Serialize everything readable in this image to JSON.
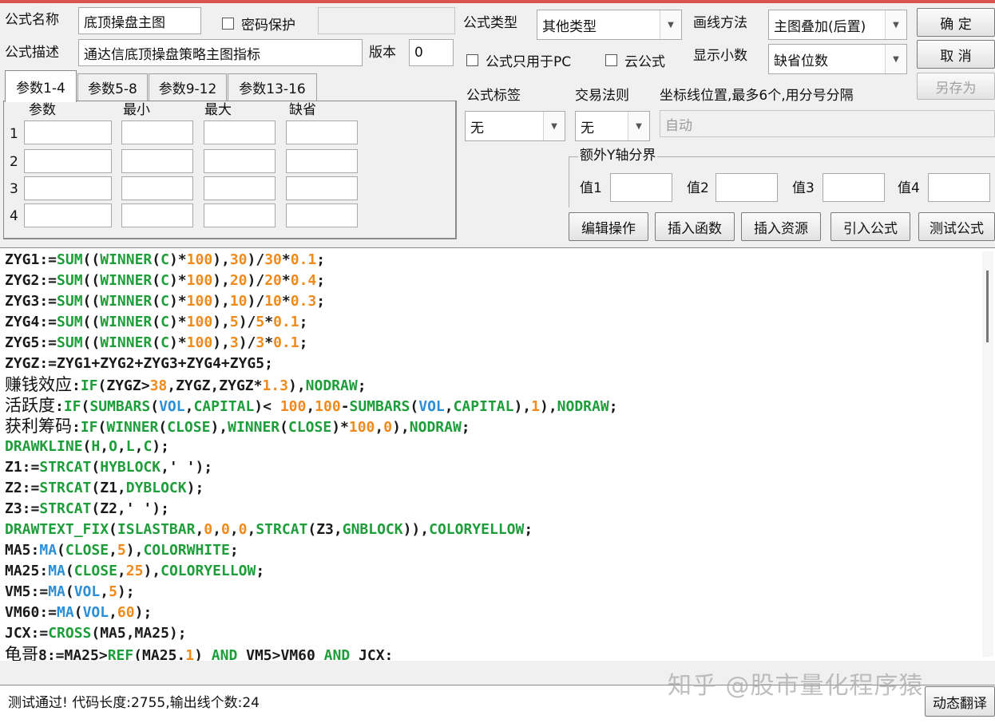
{
  "form": {
    "name_label": "公式名称",
    "name_value": "底顶操盘主图",
    "password_label": "密码保护",
    "desc_label": "公式描述",
    "desc_value": "通达信底顶操盘策略主图指标",
    "version_label": "版本",
    "version_value": "0",
    "type_label": "公式类型",
    "type_value": "其他类型",
    "draw_label": "画线方法",
    "draw_value": "主图叠加(后置)",
    "pc_only_label": "公式只用于PC",
    "cloud_label": "云公式",
    "decimals_label": "显示小数",
    "decimals_value": "缺省位数",
    "tag_label": "公式标签",
    "tag_value": "无",
    "rule_label": "交易法则",
    "rule_value": "无",
    "coord_label": "坐标线位置,最多6个,用分号分隔",
    "coord_placeholder": "自动",
    "yaxis_label": "额外Y轴分界",
    "y_values": [
      "值1",
      "值2",
      "值3",
      "值4"
    ]
  },
  "buttons": {
    "ok": "确  定",
    "cancel": "取  消",
    "save_as": "另存为",
    "edit": "编辑操作",
    "insert_func": "插入函数",
    "insert_res": "插入资源",
    "import": "引入公式",
    "test": "测试公式",
    "translate": "动态翻译"
  },
  "tabs": [
    "参数1-4",
    "参数5-8",
    "参数9-12",
    "参数13-16"
  ],
  "param_headers": [
    "参数",
    "最小",
    "最大",
    "缺省"
  ],
  "param_rows": [
    "1",
    "2",
    "3",
    "4"
  ],
  "code_lines": [
    [
      [
        "k",
        "ZYG1:="
      ],
      [
        "f",
        "SUM"
      ],
      [
        "k",
        "(("
      ],
      [
        "f",
        "WINNER"
      ],
      [
        "k",
        "("
      ],
      [
        "f",
        "C"
      ],
      [
        "k",
        ")*"
      ],
      [
        "n",
        "100"
      ],
      [
        "k",
        "),"
      ],
      [
        "n",
        "30"
      ],
      [
        "k",
        ")/"
      ],
      [
        "n",
        "30"
      ],
      [
        "k",
        "*"
      ],
      [
        "n",
        "0.1"
      ],
      [
        "k",
        ";"
      ]
    ],
    [
      [
        "k",
        "ZYG2:="
      ],
      [
        "f",
        "SUM"
      ],
      [
        "k",
        "(("
      ],
      [
        "f",
        "WINNER"
      ],
      [
        "k",
        "("
      ],
      [
        "f",
        "C"
      ],
      [
        "k",
        ")*"
      ],
      [
        "n",
        "100"
      ],
      [
        "k",
        "),"
      ],
      [
        "n",
        "20"
      ],
      [
        "k",
        ")/"
      ],
      [
        "n",
        "20"
      ],
      [
        "k",
        "*"
      ],
      [
        "n",
        "0.4"
      ],
      [
        "k",
        ";"
      ]
    ],
    [
      [
        "k",
        "ZYG3:="
      ],
      [
        "f",
        "SUM"
      ],
      [
        "k",
        "(("
      ],
      [
        "f",
        "WINNER"
      ],
      [
        "k",
        "("
      ],
      [
        "f",
        "C"
      ],
      [
        "k",
        ")*"
      ],
      [
        "n",
        "100"
      ],
      [
        "k",
        "),"
      ],
      [
        "n",
        "10"
      ],
      [
        "k",
        ")/"
      ],
      [
        "n",
        "10"
      ],
      [
        "k",
        "*"
      ],
      [
        "n",
        "0.3"
      ],
      [
        "k",
        ";"
      ]
    ],
    [
      [
        "k",
        "ZYG4:="
      ],
      [
        "f",
        "SUM"
      ],
      [
        "k",
        "(("
      ],
      [
        "f",
        "WINNER"
      ],
      [
        "k",
        "("
      ],
      [
        "f",
        "C"
      ],
      [
        "k",
        ")*"
      ],
      [
        "n",
        "100"
      ],
      [
        "k",
        "),"
      ],
      [
        "n",
        "5"
      ],
      [
        "k",
        ")/"
      ],
      [
        "n",
        "5"
      ],
      [
        "k",
        "*"
      ],
      [
        "n",
        "0.1"
      ],
      [
        "k",
        ";"
      ]
    ],
    [
      [
        "k",
        "ZYG5:="
      ],
      [
        "f",
        "SUM"
      ],
      [
        "k",
        "(("
      ],
      [
        "f",
        "WINNER"
      ],
      [
        "k",
        "("
      ],
      [
        "f",
        "C"
      ],
      [
        "k",
        ")*"
      ],
      [
        "n",
        "100"
      ],
      [
        "k",
        "),"
      ],
      [
        "n",
        "3"
      ],
      [
        "k",
        ")/"
      ],
      [
        "n",
        "3"
      ],
      [
        "k",
        "*"
      ],
      [
        "n",
        "0.1"
      ],
      [
        "k",
        ";"
      ]
    ],
    [
      [
        "k",
        "ZYGZ:=ZYG1+ZYG2+ZYG3+ZYG4+ZYG5;"
      ]
    ],
    [
      [
        "c",
        "赚钱效应"
      ],
      [
        "k",
        ":"
      ],
      [
        "f",
        "IF"
      ],
      [
        "k",
        "(ZYGZ>"
      ],
      [
        "n",
        "38"
      ],
      [
        "k",
        ",ZYGZ,ZYGZ*"
      ],
      [
        "n",
        "1.3"
      ],
      [
        "k",
        "),"
      ],
      [
        "f",
        "NODRAW"
      ],
      [
        "k",
        ";"
      ]
    ],
    [
      [
        "c",
        "活跃度"
      ],
      [
        "k",
        ":"
      ],
      [
        "f",
        "IF"
      ],
      [
        "k",
        "("
      ],
      [
        "f",
        "SUMBARS"
      ],
      [
        "k",
        "("
      ],
      [
        "b",
        "VOL"
      ],
      [
        "k",
        ","
      ],
      [
        "f",
        "CAPITAL"
      ],
      [
        "k",
        ")< "
      ],
      [
        "n",
        "100"
      ],
      [
        "k",
        ","
      ],
      [
        "n",
        "100"
      ],
      [
        "k",
        "-"
      ],
      [
        "f",
        "SUMBARS"
      ],
      [
        "k",
        "("
      ],
      [
        "b",
        "VOL"
      ],
      [
        "k",
        ","
      ],
      [
        "f",
        "CAPITAL"
      ],
      [
        "k",
        "),"
      ],
      [
        "n",
        "1"
      ],
      [
        "k",
        "),"
      ],
      [
        "f",
        "NODRAW"
      ],
      [
        "k",
        ";"
      ]
    ],
    [
      [
        "c",
        "获利筹码"
      ],
      [
        "k",
        ":"
      ],
      [
        "f",
        "IF"
      ],
      [
        "k",
        "("
      ],
      [
        "f",
        "WINNER"
      ],
      [
        "k",
        "("
      ],
      [
        "f",
        "CLOSE"
      ],
      [
        "k",
        "),"
      ],
      [
        "f",
        "WINNER"
      ],
      [
        "k",
        "("
      ],
      [
        "f",
        "CLOSE"
      ],
      [
        "k",
        ")*"
      ],
      [
        "n",
        "100"
      ],
      [
        "k",
        ","
      ],
      [
        "n",
        "0"
      ],
      [
        "k",
        "),"
      ],
      [
        "f",
        "NODRAW"
      ],
      [
        "k",
        ";"
      ]
    ],
    [
      [
        "f",
        "DRAWKLINE"
      ],
      [
        "k",
        "("
      ],
      [
        "f",
        "H"
      ],
      [
        "k",
        ","
      ],
      [
        "f",
        "O"
      ],
      [
        "k",
        ","
      ],
      [
        "f",
        "L"
      ],
      [
        "k",
        ","
      ],
      [
        "f",
        "C"
      ],
      [
        "k",
        ");"
      ]
    ],
    [
      [
        "k",
        "Z1:="
      ],
      [
        "f",
        "STRCAT"
      ],
      [
        "k",
        "("
      ],
      [
        "f",
        "HYBLOCK"
      ],
      [
        "k",
        ",' ');"
      ]
    ],
    [
      [
        "k",
        "Z2:="
      ],
      [
        "f",
        "STRCAT"
      ],
      [
        "k",
        "(Z1,"
      ],
      [
        "f",
        "DYBLOCK"
      ],
      [
        "k",
        ");"
      ]
    ],
    [
      [
        "k",
        "Z3:="
      ],
      [
        "f",
        "STRCAT"
      ],
      [
        "k",
        "(Z2,' ');"
      ]
    ],
    [
      [
        "f",
        "DRAWTEXT_FIX"
      ],
      [
        "k",
        "("
      ],
      [
        "f",
        "ISLASTBAR"
      ],
      [
        "k",
        ","
      ],
      [
        "n",
        "0"
      ],
      [
        "k",
        ","
      ],
      [
        "n",
        "0"
      ],
      [
        "k",
        ","
      ],
      [
        "n",
        "0"
      ],
      [
        "k",
        ","
      ],
      [
        "f",
        "STRCAT"
      ],
      [
        "k",
        "(Z3,"
      ],
      [
        "f",
        "GNBLOCK"
      ],
      [
        "k",
        "))"
      ],
      [
        "k",
        ","
      ],
      [
        "f",
        "COLORYELLOW"
      ],
      [
        "k",
        ";"
      ]
    ],
    [
      [
        "k",
        "MA5:"
      ],
      [
        "b",
        "MA"
      ],
      [
        "k",
        "("
      ],
      [
        "f",
        "CLOSE"
      ],
      [
        "k",
        ","
      ],
      [
        "n",
        "5"
      ],
      [
        "k",
        "),"
      ],
      [
        "f",
        "COLORWHITE"
      ],
      [
        "k",
        ";"
      ]
    ],
    [
      [
        "k",
        "MA25:"
      ],
      [
        "b",
        "MA"
      ],
      [
        "k",
        "("
      ],
      [
        "f",
        "CLOSE"
      ],
      [
        "k",
        ","
      ],
      [
        "n",
        "25"
      ],
      [
        "k",
        "),"
      ],
      [
        "f",
        "COLORYELLOW"
      ],
      [
        "k",
        ";"
      ]
    ],
    [
      [
        "k",
        "VM5:="
      ],
      [
        "b",
        "MA"
      ],
      [
        "k",
        "("
      ],
      [
        "b",
        "VOL"
      ],
      [
        "k",
        ","
      ],
      [
        "n",
        "5"
      ],
      [
        "k",
        ");"
      ]
    ],
    [
      [
        "k",
        "VM60:="
      ],
      [
        "b",
        "MA"
      ],
      [
        "k",
        "("
      ],
      [
        "b",
        "VOL"
      ],
      [
        "k",
        ","
      ],
      [
        "n",
        "60"
      ],
      [
        "k",
        ");"
      ]
    ],
    [
      [
        "k",
        "JCX:="
      ],
      [
        "f",
        "CROSS"
      ],
      [
        "k",
        "(MA5,MA25);"
      ]
    ],
    [
      [
        "c",
        "龟哥"
      ],
      [
        "k",
        "8:=MA25>"
      ],
      [
        "f",
        "REF"
      ],
      [
        "k",
        "(MA25."
      ],
      [
        "n",
        "1"
      ],
      [
        "k",
        ") "
      ],
      [
        "f",
        "AND"
      ],
      [
        "k",
        " VM5>VM60 "
      ],
      [
        "f",
        "AND"
      ],
      [
        "k",
        " JCX:"
      ]
    ]
  ],
  "status_text": "测试通过! 代码长度:2755,输出线个数:24",
  "watermark": "知乎 @股市量化程序猿"
}
